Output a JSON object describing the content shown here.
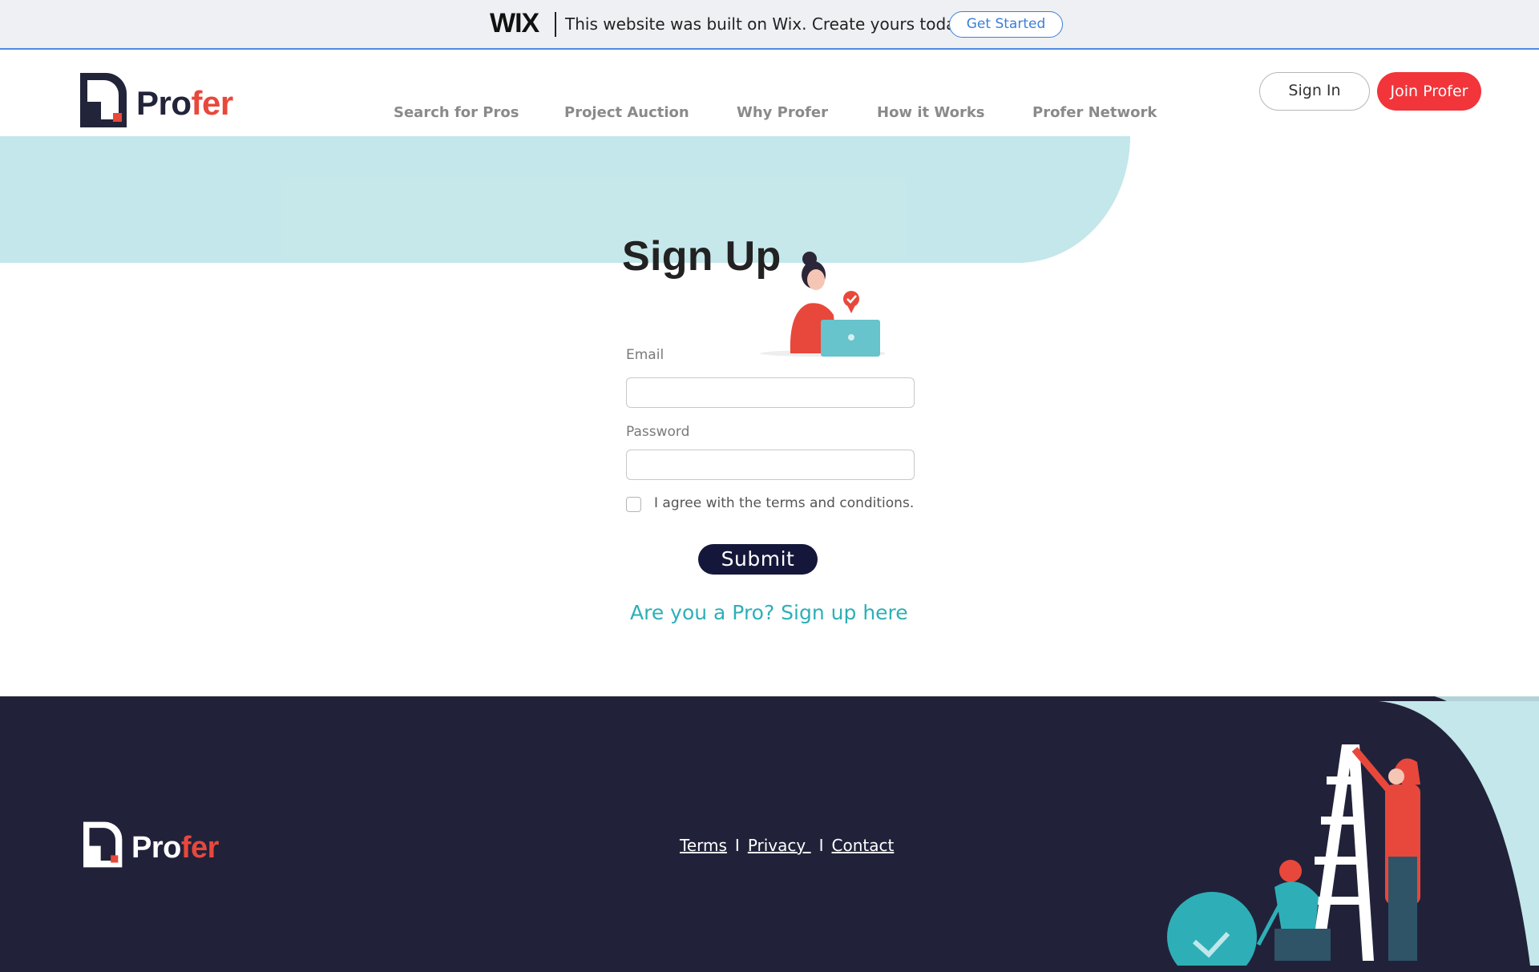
{
  "wix_banner": {
    "logo": "WIX",
    "message": "This website was built on Wix. Create yours today.",
    "cta": "Get Started",
    "accent_color": "#3b7ed8"
  },
  "header": {
    "logo": {
      "part1": "Pro",
      "part2": "fer"
    },
    "nav": [
      {
        "label": "Search for Pros"
      },
      {
        "label": "Project Auction"
      },
      {
        "label": "Why Profer"
      },
      {
        "label": "How it Works"
      },
      {
        "label": "Profer Network"
      }
    ],
    "sign_in": "Sign In",
    "join": "Join Profer",
    "brand_red": "#f2353a"
  },
  "form": {
    "title": "Sign Up",
    "email_label": "Email",
    "email_value": "",
    "password_label": "Password",
    "password_value": "",
    "agree_label": "I agree with the terms and conditions.",
    "agree_checked": false,
    "submit": "Submit",
    "pro_link": "Are you a Pro? Sign up here",
    "link_color": "#2eafb7"
  },
  "footer": {
    "logo": {
      "part1": "Pro",
      "part2": "fer"
    },
    "links": [
      "Terms",
      "Privacy ",
      "Contact"
    ],
    "separator": "I",
    "background": "#21223a"
  }
}
